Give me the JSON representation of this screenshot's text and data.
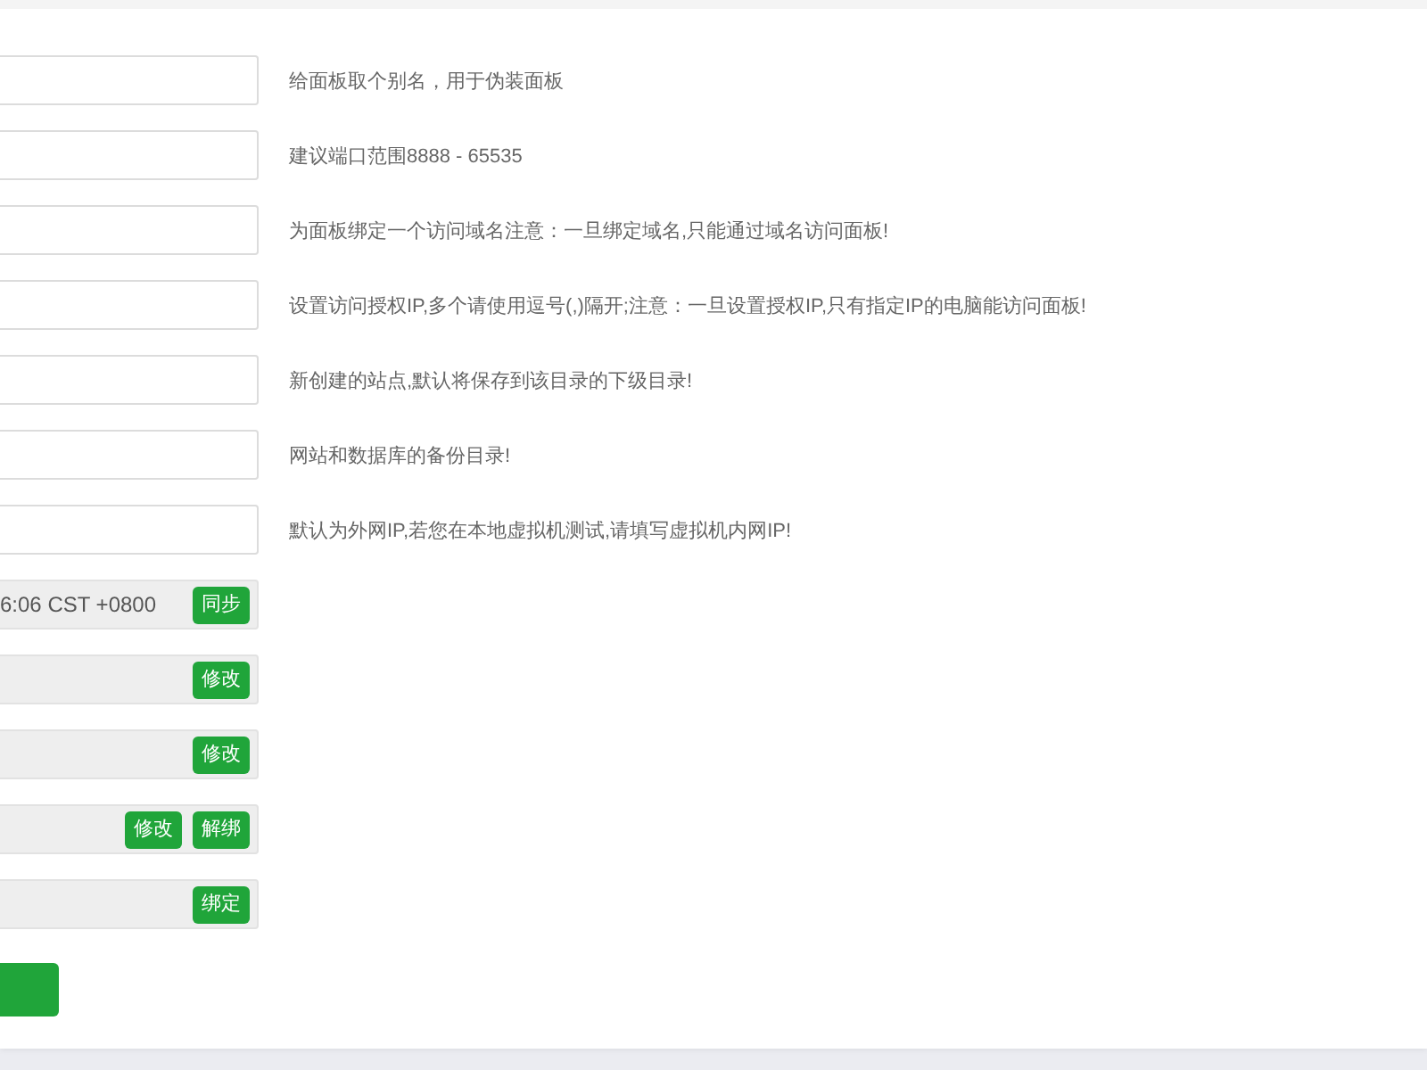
{
  "form": {
    "rows": [
      {
        "kind": "input",
        "help": "给面板取个别名，用于伪装面板"
      },
      {
        "kind": "input",
        "help": "建议端口范围8888 - 65535"
      },
      {
        "kind": "input",
        "help": "为面板绑定一个访问域名注意：一旦绑定域名,只能通过域名访问面板!"
      },
      {
        "kind": "input",
        "help": "设置访问授权IP,多个请使用逗号(,)隔开;注意：一旦设置授权IP,只有指定IP的电脑能访问面板!"
      },
      {
        "kind": "input",
        "help": "新创建的站点,默认将保存到该目录的下级目录!"
      },
      {
        "kind": "input",
        "help": "网站和数据库的备份目录!"
      },
      {
        "kind": "input",
        "help": "默认为外网IP,若您在本地虚拟机测试,请填写虚拟机内网IP!"
      },
      {
        "kind": "readonly",
        "value": "6:06 CST +0800",
        "buttons": [
          "同步"
        ]
      },
      {
        "kind": "readonly",
        "buttons": [
          "修改"
        ]
      },
      {
        "kind": "readonly",
        "buttons": [
          "修改"
        ]
      },
      {
        "kind": "readonly",
        "buttons": [
          "修改",
          "解绑"
        ]
      },
      {
        "kind": "readonly",
        "buttons": [
          "绑定"
        ]
      },
      {
        "kind": "submit"
      }
    ]
  }
}
